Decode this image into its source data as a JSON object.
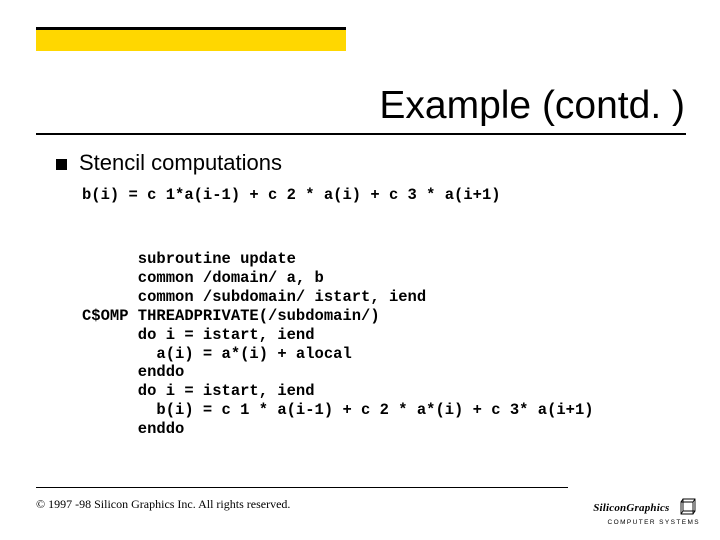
{
  "title": "Example (contd. )",
  "bullet": {
    "text": "Stencil computations"
  },
  "equation": "b(i) = c 1*a(i-1) + c 2 * a(i) + c 3 * a(i+1)",
  "code": {
    "indent_directive": "C$OMP",
    "lines": [
      "      subroutine update",
      "      common /domain/ a, b",
      "      common /subdomain/ istart, iend",
      "C$OMP THREADPRIVATE(/subdomain/)",
      "      do i = istart, iend",
      "        a(i) = a*(i) + alocal",
      "      enddo",
      "      do i = istart, iend",
      "        b(i) = c 1 * a(i-1) + c 2 * a*(i) + c 3* a(i+1)",
      "      enddo"
    ]
  },
  "footer": "© 1997 -98 Silicon Graphics Inc. All rights reserved.",
  "logo": {
    "brand": "SiliconGraphics",
    "sub": "COMPUTER  SYSTEMS"
  }
}
